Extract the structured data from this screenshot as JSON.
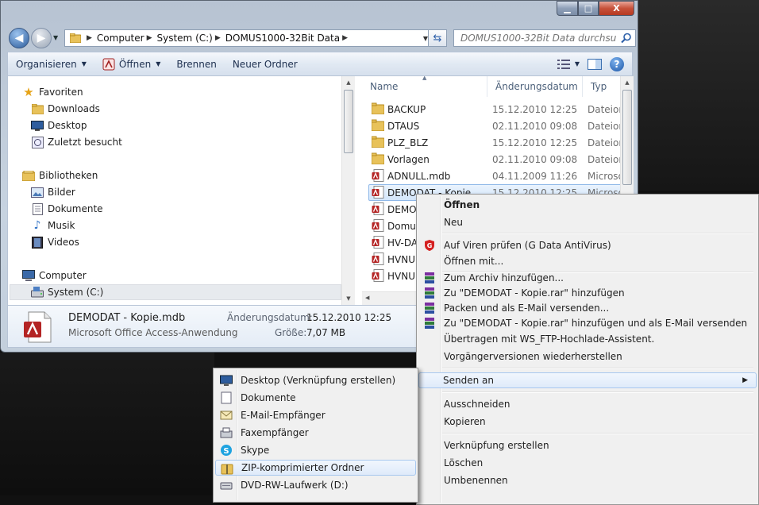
{
  "window": {
    "controls": {
      "minimize": "▁",
      "maximize": "□",
      "close": "X"
    }
  },
  "address": {
    "crumbs": [
      "Computer",
      "System (C:)",
      "DOMUS1000-32Bit Data"
    ]
  },
  "search": {
    "placeholder": "DOMUS1000-32Bit Data durchsuch..."
  },
  "toolbar": {
    "organize": "Organisieren",
    "open": "Öffnen",
    "burn": "Brennen",
    "new_folder": "Neuer Ordner"
  },
  "nav": {
    "items": [
      {
        "label": "Favoriten",
        "icon": "star-icon"
      },
      {
        "label": "Downloads",
        "icon": "folder-icon"
      },
      {
        "label": "Desktop",
        "icon": "desktop-icon"
      },
      {
        "label": "Zuletzt besucht",
        "icon": "recent-icon"
      },
      {
        "label": "Bibliotheken",
        "icon": "libraries-icon"
      },
      {
        "label": "Bilder",
        "icon": "pictures-icon"
      },
      {
        "label": "Dokumente",
        "icon": "documents-icon"
      },
      {
        "label": "Musik",
        "icon": "music-icon"
      },
      {
        "label": "Videos",
        "icon": "videos-icon"
      },
      {
        "label": "Computer",
        "icon": "computer-icon"
      },
      {
        "label": "System (C:)",
        "icon": "drive-icon"
      }
    ]
  },
  "files": {
    "columns": {
      "name": "Name",
      "date": "Änderungsdatum",
      "type": "Typ"
    },
    "rows": [
      {
        "name": "BACKUP",
        "date": "15.12.2010 12:25",
        "type": "Dateiorc",
        "kind": "folder"
      },
      {
        "name": "DTAUS",
        "date": "02.11.2010 09:08",
        "type": "Dateiorc",
        "kind": "folder"
      },
      {
        "name": "PLZ_BLZ",
        "date": "15.12.2010 12:25",
        "type": "Dateiorc",
        "kind": "folder"
      },
      {
        "name": "Vorlagen",
        "date": "02.11.2010 09:08",
        "type": "Dateiorc",
        "kind": "folder"
      },
      {
        "name": "ADNULL.mdb",
        "date": "04.11.2009 11:26",
        "type": "Microso",
        "kind": "mdb"
      },
      {
        "name": "DEMODAT - Kopie",
        "date": "15.12.2010 12:25",
        "type": "Microso",
        "kind": "mdb"
      },
      {
        "name": "DEMOD",
        "date": "",
        "type": "",
        "kind": "mdb"
      },
      {
        "name": "Domus",
        "date": "",
        "type": "",
        "kind": "mdb"
      },
      {
        "name": "HV-DAT",
        "date": "",
        "type": "",
        "kind": "mdb"
      },
      {
        "name": "HVNUL",
        "date": "",
        "type": "",
        "kind": "mdb"
      },
      {
        "name": "HVNUL",
        "date": "",
        "type": "",
        "kind": "mdb"
      }
    ]
  },
  "details": {
    "name": "DEMODAT - Kopie.mdb",
    "type": "Microsoft Office Access-Anwendung",
    "modified_label": "Änderungsdatum:",
    "modified_value": "15.12.2010 12:25",
    "size_label": "Größe:",
    "size_value": "7,07 MB"
  },
  "context_menu": {
    "open": "Öffnen",
    "new": "Neu",
    "virus_scan": "Auf Viren prüfen (G Data AntiVirus)",
    "open_with": "Öffnen mit...",
    "add_archive": "Zum Archiv hinzufügen...",
    "add_rar": "Zu \"DEMODAT - Kopie.rar\" hinzufügen",
    "pack_email": "Packen und als E-Mail versenden...",
    "rar_email": "Zu \"DEMODAT - Kopie.rar\" hinzufügen und als E-Mail versenden",
    "ftp": "Übertragen mit WS_FTP-Hochlade-Assistent.",
    "restore": "Vorgängerversionen wiederherstellen",
    "send_to": "Senden an",
    "cut": "Ausschneiden",
    "copy": "Kopieren",
    "shortcut": "Verknüpfung erstellen",
    "delete": "Löschen",
    "rename": "Umbenennen"
  },
  "send_to_menu": {
    "items": [
      {
        "label": "Desktop (Verknüpfung erstellen)",
        "icon": "desktop-icon"
      },
      {
        "label": "Dokumente",
        "icon": "documents-icon"
      },
      {
        "label": "E-Mail-Empfänger",
        "icon": "mail-icon"
      },
      {
        "label": "Faxempfänger",
        "icon": "fax-icon"
      },
      {
        "label": "Skype",
        "icon": "skype-icon"
      },
      {
        "label": "ZIP-komprimierter Ordner",
        "icon": "zip-folder-icon"
      },
      {
        "label": "DVD-RW-Laufwerk (D:)",
        "icon": "dvd-drive-icon"
      }
    ]
  },
  "colors": {
    "selection": "#d3e6fb",
    "folder": "#e8c25a",
    "accent": "#2b5ea8"
  }
}
